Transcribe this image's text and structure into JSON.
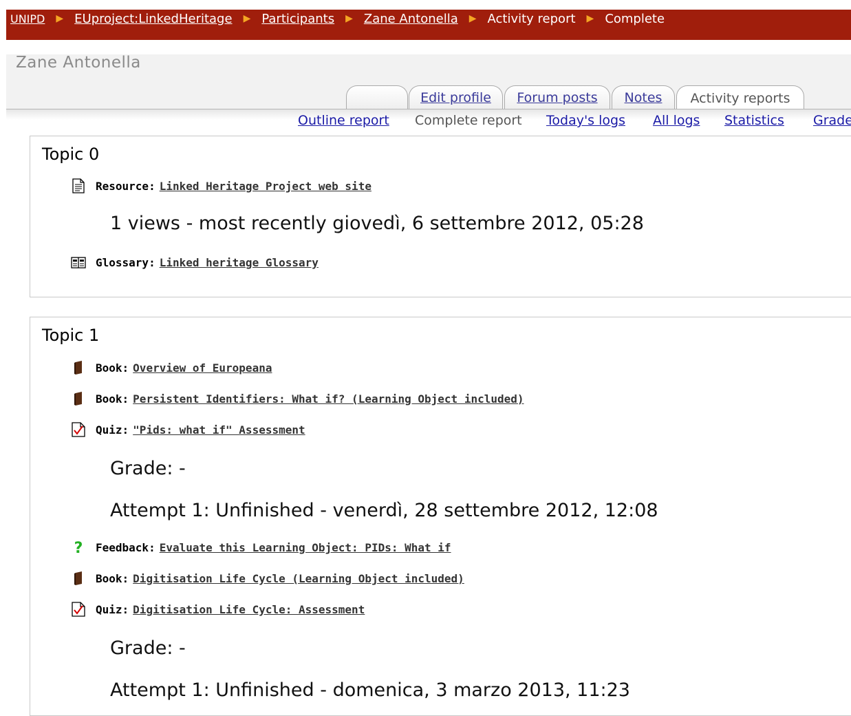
{
  "breadcrumb": {
    "items": [
      "UNIPD",
      "EUproject:LinkedHeritage",
      "Participants",
      "Zane Antonella",
      "Activity report",
      "Complete"
    ],
    "separator": "▶"
  },
  "user_heading": "Zane Antonella",
  "tabs": [
    {
      "label": "",
      "active": false
    },
    {
      "label": "Edit profile",
      "active": false
    },
    {
      "label": "Forum posts",
      "active": false
    },
    {
      "label": "Notes",
      "active": false
    },
    {
      "label": "Activity reports",
      "active": true
    }
  ],
  "subtabs": [
    {
      "label": "Outline report",
      "current": false
    },
    {
      "label": "Complete report",
      "current": true
    },
    {
      "label": "Today's logs",
      "current": false
    },
    {
      "label": "All logs",
      "current": false
    },
    {
      "label": "Statistics",
      "current": false
    },
    {
      "label": "Grade",
      "current": false
    }
  ],
  "topics": [
    {
      "title": "Topic 0",
      "activities": [
        {
          "type": "Resource:",
          "name": "Linked Heritage Project web site",
          "icon": "resource-icon",
          "details": [
            "1 views - most recently giovedì, 6 settembre 2012, 05:28"
          ]
        },
        {
          "type": "Glossary:",
          "name": "Linked heritage Glossary",
          "icon": "glossary-icon",
          "details": []
        }
      ]
    },
    {
      "title": "Topic 1",
      "activities": [
        {
          "type": "Book:",
          "name": "Overview of Europeana",
          "icon": "book-icon",
          "details": []
        },
        {
          "type": "Book:",
          "name": "Persistent Identifiers: What if? (Learning Object included)",
          "icon": "book-icon",
          "details": []
        },
        {
          "type": "Quiz:",
          "name": "\"Pids: what if\" Assessment",
          "icon": "quiz-icon",
          "details": [
            "Grade: -",
            "Attempt 1: Unfinished - venerdì, 28 settembre 2012, 12:08"
          ]
        },
        {
          "type": "Feedback:",
          "name": "Evaluate this Learning Object: PIDs: What if",
          "icon": "feedback-icon",
          "details": []
        },
        {
          "type": "Book:",
          "name": "Digitisation Life Cycle (Learning Object included)",
          "icon": "book-icon",
          "details": []
        },
        {
          "type": "Quiz:",
          "name": "Digitisation Life Cycle: Assessment",
          "icon": "quiz-icon",
          "details": [
            "Grade: -",
            "Attempt 1: Unfinished - domenica, 3 marzo 2013, 11:23"
          ]
        }
      ]
    }
  ],
  "colors": {
    "navbar": "#a01e0c",
    "separator": "#f5a623",
    "link": "#1a1aa6"
  }
}
